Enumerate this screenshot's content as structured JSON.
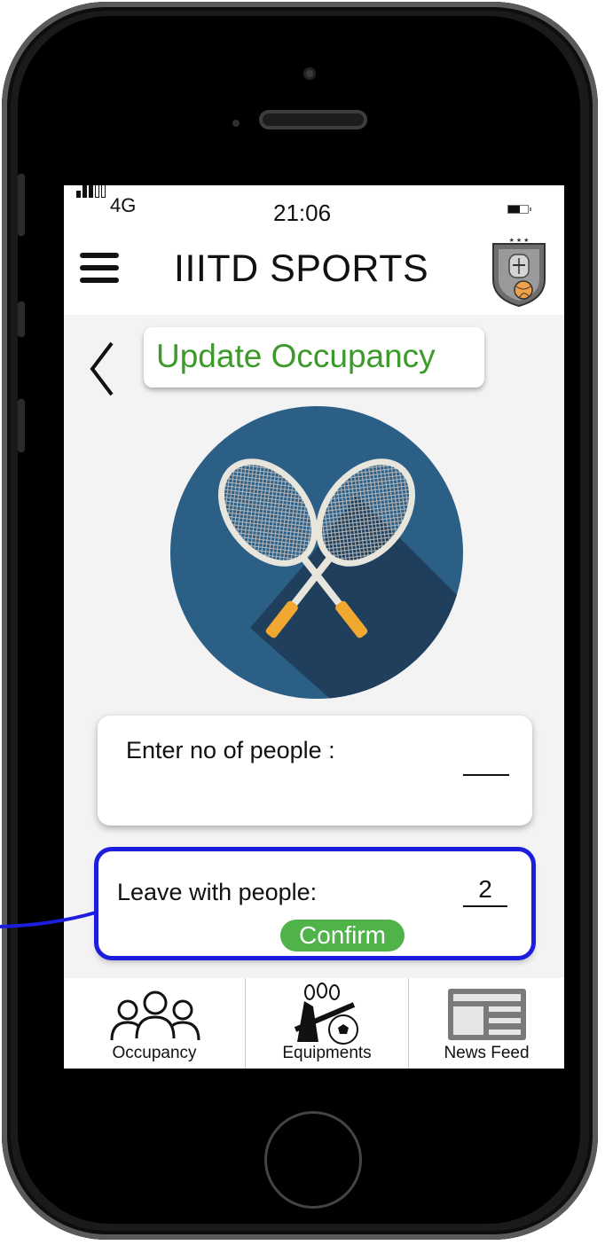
{
  "status_bar": {
    "network": "4G",
    "time": "21:06"
  },
  "header": {
    "title": "IIITD SPORTS"
  },
  "page": {
    "title": "Update Occupancy",
    "sport_icon": "badminton-rackets-icon"
  },
  "people_form": {
    "label": "Enter no of people :",
    "value": ""
  },
  "leave_form": {
    "label": "Leave with people:",
    "value": "2",
    "confirm_label": "Confirm"
  },
  "bottom_nav": {
    "items": [
      {
        "label": "Occupancy",
        "icon": "people-group-icon"
      },
      {
        "label": "Equipments",
        "icon": "sports-equipment-icon"
      },
      {
        "label": "News Feed",
        "icon": "newspaper-icon"
      }
    ]
  },
  "colors": {
    "accent_green": "#3c9a2a",
    "button_green": "#4fb34a",
    "annotation_blue": "#1d1de0",
    "icon_circle": "#2c5f86"
  }
}
